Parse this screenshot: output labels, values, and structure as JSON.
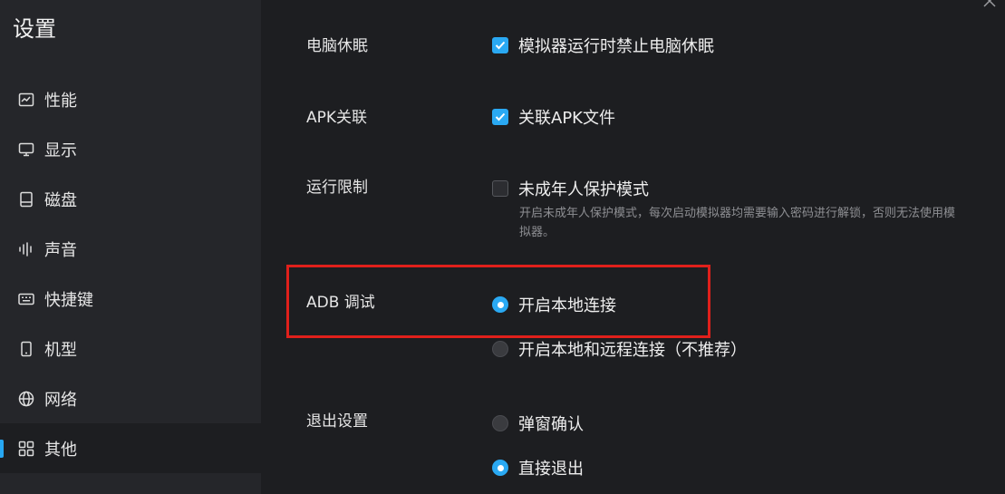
{
  "window": {
    "title": "设置"
  },
  "sidebar": {
    "items": [
      {
        "label": "性能",
        "icon": "performance-chart-icon",
        "active": false
      },
      {
        "label": "显示",
        "icon": "monitor-icon",
        "active": false
      },
      {
        "label": "磁盘",
        "icon": "disk-icon",
        "active": false
      },
      {
        "label": "声音",
        "icon": "sound-wave-icon",
        "active": false
      },
      {
        "label": "快捷键",
        "icon": "keyboard-icon",
        "active": false
      },
      {
        "label": "机型",
        "icon": "phone-icon",
        "active": false
      },
      {
        "label": "网络",
        "icon": "globe-icon",
        "active": false
      },
      {
        "label": "其他",
        "icon": "grid-icon",
        "active": true
      }
    ]
  },
  "settings": {
    "sleep": {
      "label": "电脑休眠",
      "option": "模拟器运行时禁止电脑休眠",
      "checked": true
    },
    "apk": {
      "label": "APK关联",
      "option": "关联APK文件",
      "checked": true
    },
    "limit": {
      "label": "运行限制",
      "option": "未成年人保护模式",
      "checked": false,
      "hint": "开启未成年人保护模式，每次启动模拟器均需要输入密码进行解锁，否则无法使用模拟器。"
    },
    "adb": {
      "label": "ADB 调试",
      "options": [
        {
          "label": "开启本地连接",
          "selected": true
        },
        {
          "label": "开启本地和远程连接（不推荐）",
          "selected": false
        }
      ]
    },
    "exit": {
      "label": "退出设置",
      "options": [
        {
          "label": "弹窗确认",
          "selected": false
        },
        {
          "label": "直接退出",
          "selected": true
        }
      ]
    }
  },
  "colors": {
    "accent": "#2aa9f3",
    "highlight": "#e0201b",
    "background": "#1d1e21",
    "sidebar": "#25262a"
  }
}
